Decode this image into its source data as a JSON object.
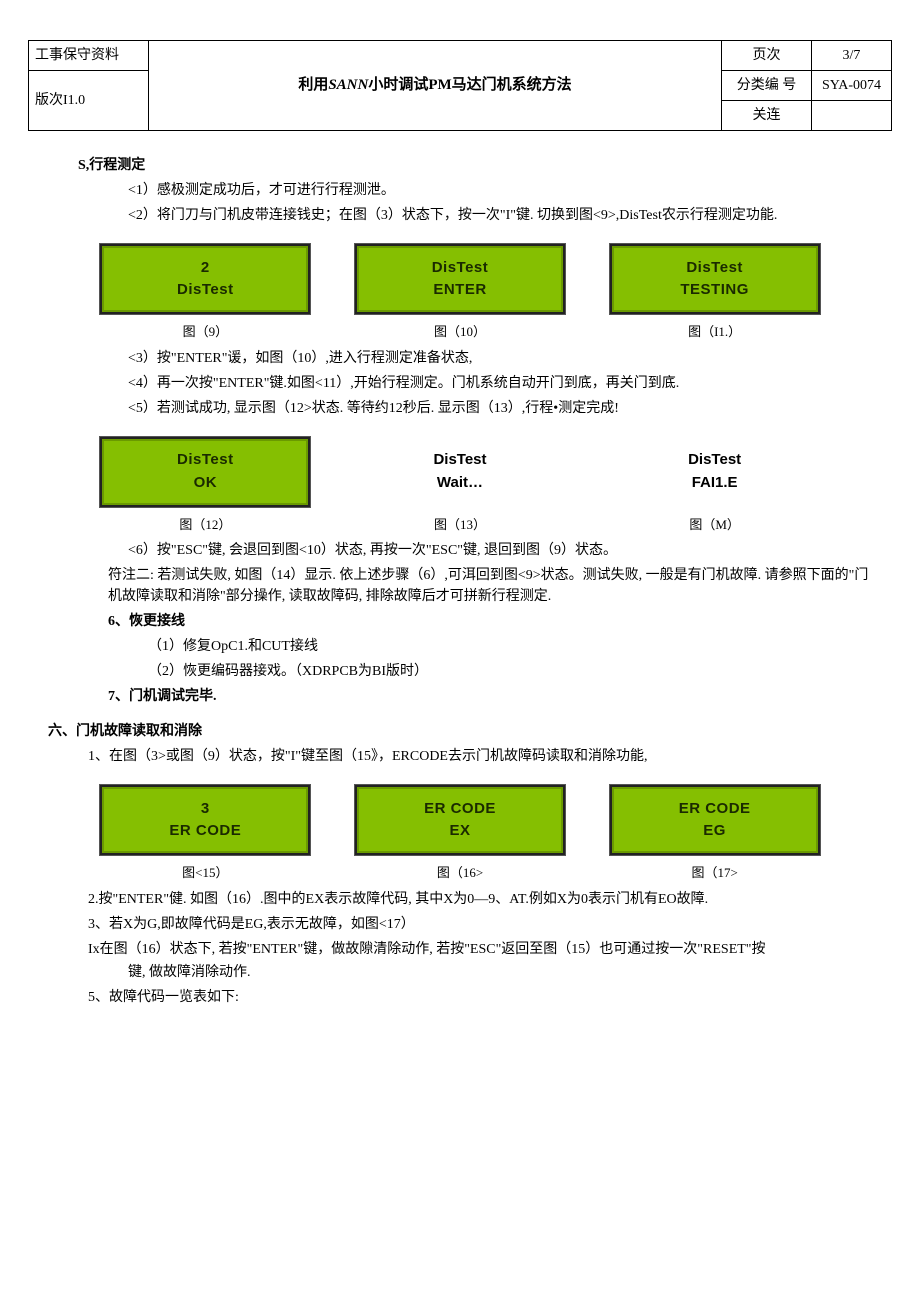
{
  "header": {
    "left1": "工事保守资料",
    "left2": "版次I1.0",
    "title_pre": "利用",
    "title_ital": "SANN",
    "title_post": "小时调试PM马达门机系统方法",
    "r1_label": "页次",
    "r1_val": "3/7",
    "r2_label": "分类编 号",
    "r2_val": "SYA-0074",
    "r3_label": "关连",
    "r3_val": ""
  },
  "sec_s": {
    "title": "S,行程测定",
    "p1": "<1）感极测定成功后，才可进行行程测泄。",
    "p2": "<2）将门刀与门机皮带连接钱史；在图（3）状态下，按一次\"I\"键. 切换到图<9>,DisTest农示行程测定功能."
  },
  "lcd_row1": [
    {
      "line1": "2",
      "line2": "DisTest",
      "caption": "图（9）",
      "plain": false
    },
    {
      "line1": "DisTest",
      "line2": "ENTER",
      "caption": "图（10）",
      "plain": false
    },
    {
      "line1": "DisTest",
      "line2": "TESTING",
      "caption": "图（I1.）",
      "plain": false
    }
  ],
  "sec_s2": {
    "p3": "<3）按\"ENTER\"谖，如图（10）,进入行程测定准备状态,",
    "p4": "<4）再一次按\"ENTER\"键.如图<11）,开始行程测定。门机系统自动开门到底，再关门到底.",
    "p5": "<5）若测试成功, 显示图（12>状态. 等待约12秒后. 显示图（13）,行程•测定完成!"
  },
  "lcd_row2": [
    {
      "line1": "DisTest",
      "line2": "OK",
      "caption": "图（12）",
      "plain": false
    },
    {
      "line1": "DisTest",
      "line2": "Wait…",
      "caption": "图（13）",
      "plain": true
    },
    {
      "line1": "DisTest",
      "line2": "FAI1.E",
      "caption": "图（M）",
      "plain": true
    }
  ],
  "sec_s3": {
    "p6": "<6）按\"ESC\"键, 会退回到图<10）状态, 再按一次\"ESC\"键, 退回到图（9）状态。",
    "note": "符注二: 若测试失败, 如图（14）显示. 依上述步骤（6）,可洱回到图<9>状态。测试失败, 一般是有门机故障. 请参照下面的\"门机故障读取和消除\"部分操作, 读取故障码, 排除故障后才可拼新行程测定.",
    "p6_title": "6、恢更接线",
    "p6_1": "（1）修复OpC1.和CUT接线",
    "p6_2": "（2）恢更编码器接戏。（XDRPCB为BI版时）",
    "p7": "7、门机调试完毕."
  },
  "sec6": {
    "title": "六、门机故障读取和消除",
    "p1": "1、在图（3>或图（9）状态，按\"I\"键至图（15》，ERCODE去示门机故障码读取和消除功能,"
  },
  "lcd_row3": [
    {
      "line1": "3",
      "line2": "ER CODE",
      "caption": "图<15）",
      "plain": false
    },
    {
      "line1": "ER CODE",
      "line2": "EX",
      "caption": "图（16>",
      "plain": false
    },
    {
      "line1": "ER CODE",
      "line2": "EG",
      "caption": "图（17>",
      "plain": false
    }
  ],
  "sec6b": {
    "p2": "2.按\"ENTER\"健. 如图（16）.图中的EX表示故障代码, 其中X为0—9、AT.例如X为0表示门机有EO故障.",
    "p3": "3、若X为G,即故障代码是EG,表示无故障，如图<17）",
    "p4a": "Ix在图（16）状态下, 若按\"ENTER\"键，做故隙清除动作, 若按\"ESC\"返回至图（15）也可通过按一次\"RESET\"按",
    "p4b": "键, 做故障消除动作.",
    "p5": "5、故障代码一览表如下:"
  }
}
